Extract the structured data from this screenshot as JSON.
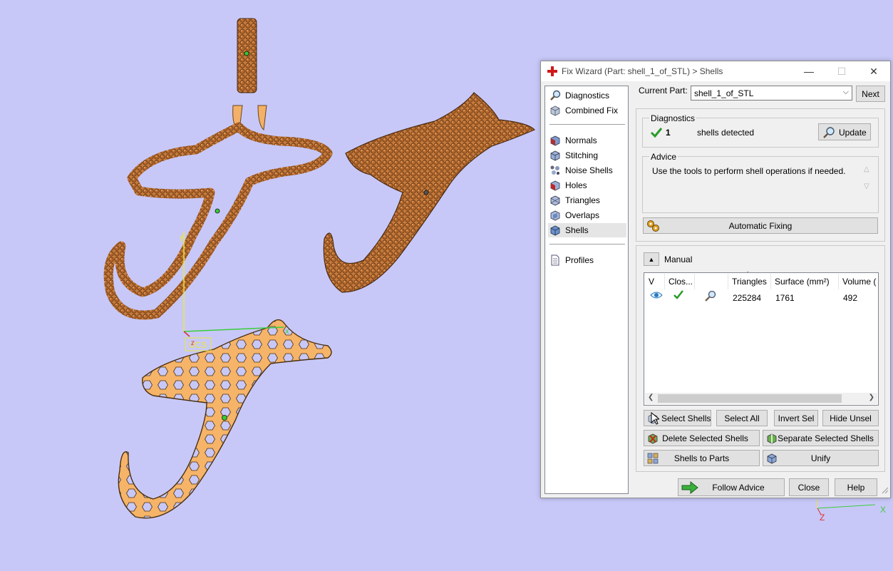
{
  "viewport": {
    "ucs_label": "UCS",
    "axis_x": "x",
    "axis_y": "y",
    "axis_z": "z",
    "corner_axis_x": "X",
    "corner_axis_z": "Z"
  },
  "window": {
    "title": "Fix Wizard (Part: shell_1_of_STL) > Shells",
    "minimize": "—",
    "maximize": "☐",
    "close": "✕"
  },
  "nav": {
    "items": [
      {
        "label": "Diagnostics",
        "icon": "magnifier-icon"
      },
      {
        "label": "Combined Fix",
        "icon": "cube-icon"
      },
      {
        "label": "Normals",
        "icon": "normals-cube-icon"
      },
      {
        "label": "Stitching",
        "icon": "stitching-cube-icon"
      },
      {
        "label": "Noise Shells",
        "icon": "noise-shells-icon"
      },
      {
        "label": "Holes",
        "icon": "holes-cube-icon"
      },
      {
        "label": "Triangles",
        "icon": "triangles-cube-icon"
      },
      {
        "label": "Overlaps",
        "icon": "overlaps-cube-icon"
      },
      {
        "label": "Shells",
        "icon": "shells-cube-icon"
      },
      {
        "label": "Profiles",
        "icon": "document-icon"
      }
    ],
    "selected": "Shells"
  },
  "current_part": {
    "label": "Current Part:",
    "value": "shell_1_of_STL",
    "next": "Next"
  },
  "diagnostics": {
    "title": "Diagnostics",
    "count": "1",
    "text": "shells detected",
    "update": "Update"
  },
  "advice": {
    "title": "Advice",
    "text": "Use the tools to perform shell operations if needed.",
    "auto_fix": "Automatic Fixing"
  },
  "manual": {
    "title": "Manual",
    "table": {
      "headers": [
        "V",
        "Clos...",
        "",
        "Triangles",
        "Surface (mm²)",
        "Volume ("
      ],
      "rows": [
        {
          "visible": "eye-icon",
          "closed": "checkmark-icon",
          "inspect": "magnifier-icon",
          "triangles": "225284",
          "surface": "1761",
          "volume": "492"
        }
      ]
    },
    "buttons": {
      "select_shells": "Select Shells",
      "select_all": "Select All",
      "invert_sel": "Invert Sel",
      "hide_unsel": "Hide Unsel",
      "delete_selected": "Delete Selected Shells",
      "separate_selected": "Separate Selected Shells",
      "shells_to_parts": "Shells to Parts",
      "unify": "Unify"
    }
  },
  "footer": {
    "follow_advice": "Follow Advice",
    "close": "Close",
    "help": "Help"
  },
  "colors": {
    "background": "#c8c8f8",
    "jewelry_fill": "#f6b469",
    "jewelry_dark": "#b06a2a",
    "check_green": "#2a9a2a"
  }
}
